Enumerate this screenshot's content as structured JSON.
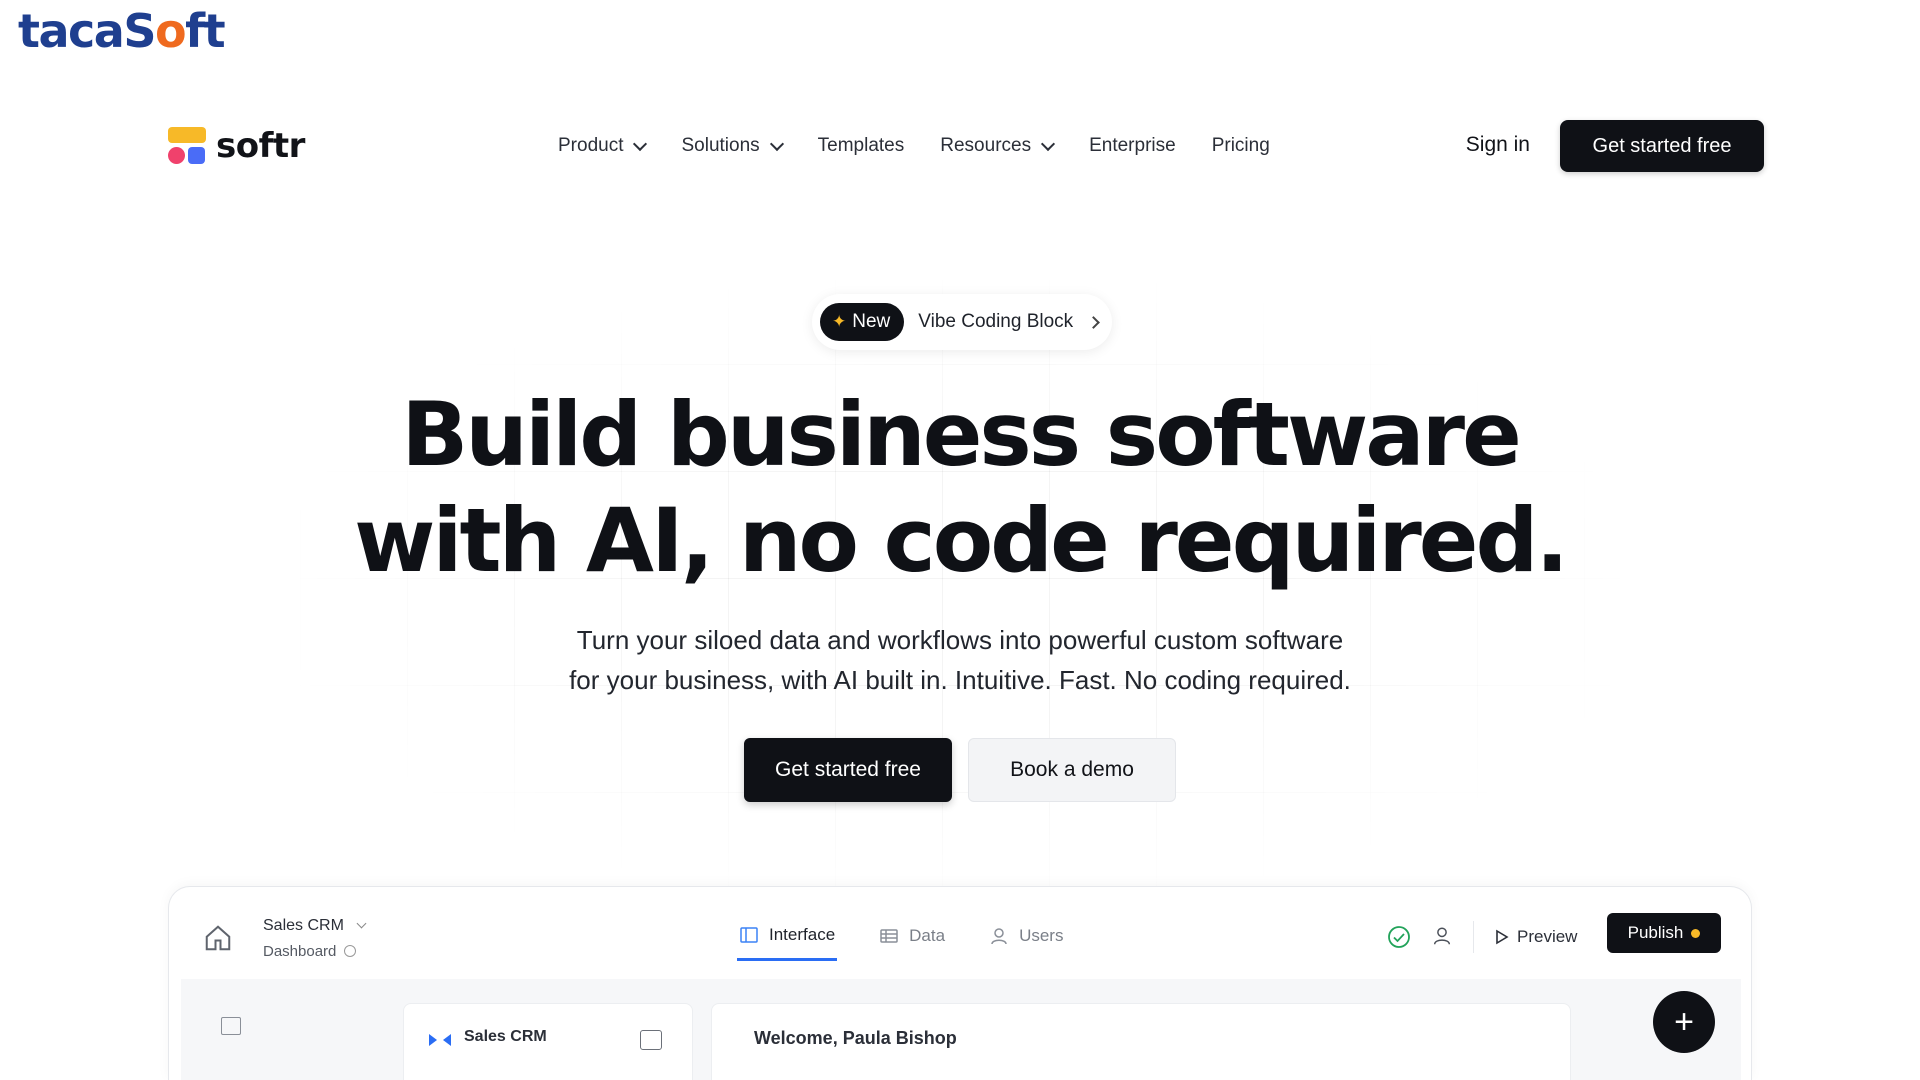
{
  "watermark": {
    "pre": "taca",
    "mid": "S",
    "o": "o",
    "post": "ft"
  },
  "brand": {
    "name": "softr"
  },
  "nav": {
    "items": [
      {
        "label": "Product",
        "dropdown": true
      },
      {
        "label": "Solutions",
        "dropdown": true
      },
      {
        "label": "Templates",
        "dropdown": false
      },
      {
        "label": "Resources",
        "dropdown": true
      },
      {
        "label": "Enterprise",
        "dropdown": false
      },
      {
        "label": "Pricing",
        "dropdown": false
      }
    ],
    "signin": "Sign in",
    "cta": "Get started free"
  },
  "badge": {
    "tag": "New",
    "text": "Vibe Coding Block"
  },
  "hero": {
    "line1": "Build business software",
    "line2": "with AI, no code required.",
    "sub1": "Turn your siloed data and workflows into powerful custom software",
    "sub2": "for your business, with AI built in. Intuitive. Fast. No coding required.",
    "primary_cta": "Get started free",
    "secondary_cta": "Book a demo"
  },
  "app": {
    "app_name": "Sales CRM",
    "page_name": "Dashboard",
    "tabs": [
      {
        "label": "Interface",
        "active": true,
        "icon": "layout-icon"
      },
      {
        "label": "Data",
        "active": false,
        "icon": "table-icon"
      },
      {
        "label": "Users",
        "active": false,
        "icon": "user-icon"
      }
    ],
    "preview": "Preview",
    "publish": "Publish",
    "card_title": "Sales CRM",
    "main_title": "Welcome, Paula Bishop"
  },
  "colors": {
    "accent_blue": "#2a6df4",
    "brand_yellow": "#f7b928",
    "brand_pink": "#f0416c",
    "brand_blue": "#4a6cf7",
    "dark": "#0f1116"
  }
}
